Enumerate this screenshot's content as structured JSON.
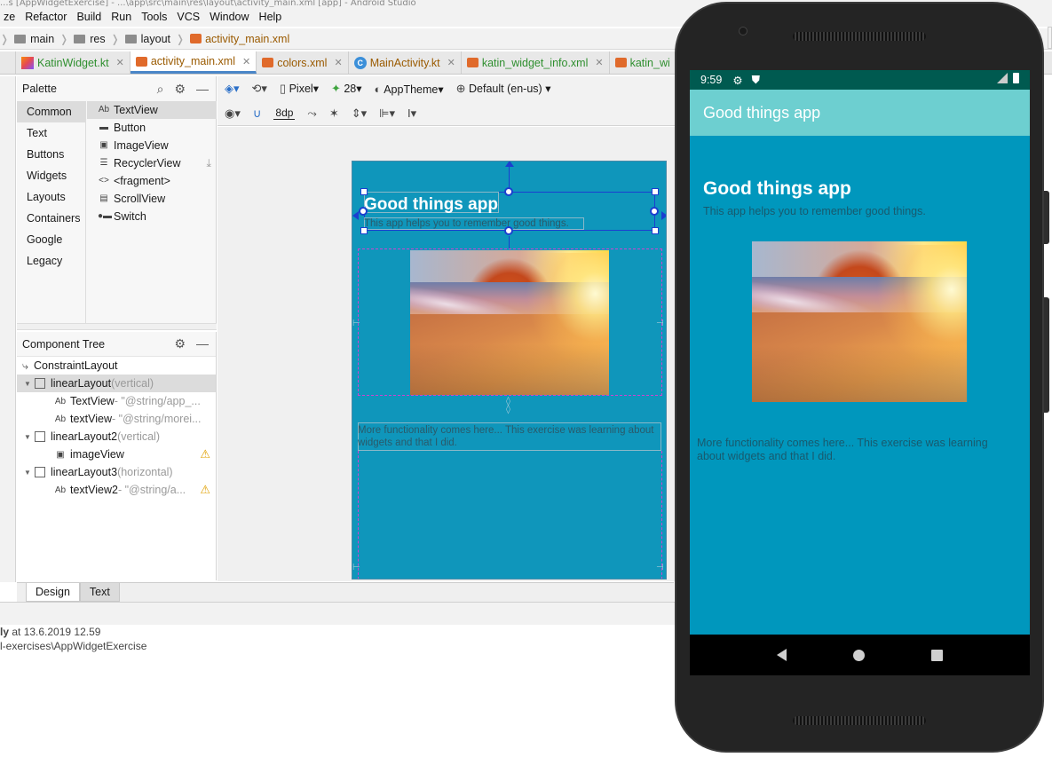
{
  "window": {
    "title_fragment": "...s [AppWidgetExercise] - ...\\app\\src\\main\\res\\layout\\activity_main.xml [app] - Android Studio"
  },
  "menu": [
    "ze",
    "Refactor",
    "Build",
    "Run",
    "Tools",
    "VCS",
    "Window",
    "Help"
  ],
  "breadcrumb": [
    "main",
    "res",
    "layout",
    "activity_main.xml"
  ],
  "tabs": [
    {
      "label": "KatinWidget.kt"
    },
    {
      "label": "activity_main.xml"
    },
    {
      "label": "colors.xml"
    },
    {
      "label": "MainActivity.kt"
    },
    {
      "label": "katin_widget_info.xml"
    },
    {
      "label": "katin_wi"
    }
  ],
  "palette": {
    "title": "Palette",
    "categories": [
      "Common",
      "Text",
      "Buttons",
      "Widgets",
      "Layouts",
      "Containers",
      "Google",
      "Legacy"
    ],
    "items": [
      "TextView",
      "Button",
      "ImageView",
      "RecyclerView",
      "<fragment>",
      "ScrollView",
      "Switch"
    ]
  },
  "component_tree": {
    "title": "Component Tree",
    "nodes": [
      {
        "label": "ConstraintLayout",
        "dim": ""
      },
      {
        "label": "linearLayout",
        "dim": "(vertical)"
      },
      {
        "label": "TextView",
        "dim": "- \"@string/app_..."
      },
      {
        "label": "textView",
        "dim": "- \"@string/morei..."
      },
      {
        "label": "linearLayout2",
        "dim": "(vertical)"
      },
      {
        "label": "imageView",
        "dim": ""
      },
      {
        "label": "linearLayout3",
        "dim": "(horizontal)"
      },
      {
        "label": "textView2",
        "dim": "- \"@string/a..."
      }
    ]
  },
  "design_toolbar": {
    "device": "Pixel",
    "api": "28",
    "theme": "AppTheme",
    "locale": "Default (en-us)",
    "margin": "8dp"
  },
  "bottom_tabs": [
    "Design",
    "Text"
  ],
  "status": {
    "line1_bold": "ly",
    "line1_rest": " at 13.6.2019 12.59",
    "line2": "l-exercises\\AppWidgetExercise"
  },
  "app": {
    "title": "Good things app",
    "subtitle": "This app helps you to remember good things.",
    "more_text": "More functionality comes here... This exercise was learning about widgets and that I did.",
    "time": "9:59"
  },
  "colors": {
    "blueprint_bg": "#0f96bb",
    "phone_bg": "#0097bd",
    "app_bar": "#6dcfd0",
    "status_bar": "#005a50",
    "selection": "#1b3fd0",
    "constraint_dash": "#d042d0"
  }
}
